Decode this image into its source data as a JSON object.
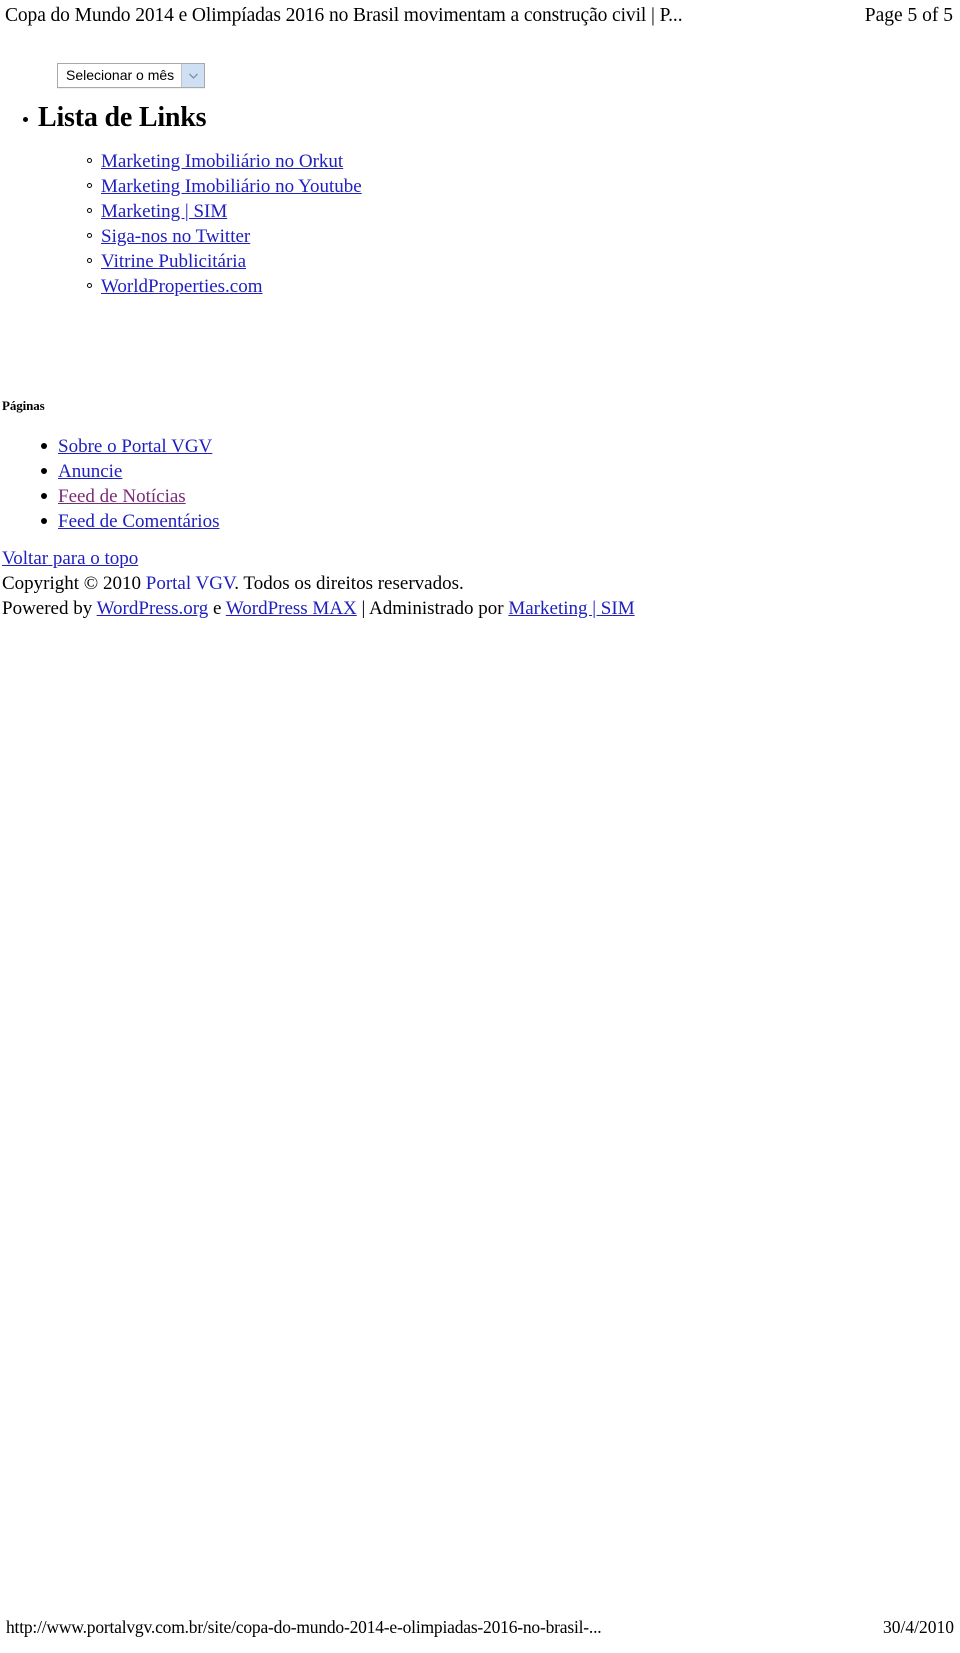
{
  "print_header": {
    "document_title": "Copa do Mundo 2014 e Olimpíadas 2016 no Brasil movimentam a construção civil | P...",
    "page_indicator": "Page 5 of 5"
  },
  "month_select": {
    "selected_label": "Selecionar o mês",
    "arrow_icon": "chevron-down-icon",
    "arrow_button_color": "#cfe0f5",
    "border_color": "#a9a9a9"
  },
  "links_widget": {
    "title": "Lista de Links",
    "items": [
      {
        "label": "Marketing Imobiliário no Orkut",
        "state": "link"
      },
      {
        "label": "Marketing Imobiliário no Youtube",
        "state": "link"
      },
      {
        "label": "Marketing | SIM",
        "state": "link"
      },
      {
        "label": "Siga-nos no Twitter",
        "state": "link"
      },
      {
        "label": "Vitrine Publicitária",
        "state": "link"
      },
      {
        "label": "WorldProperties.com",
        "state": "link"
      }
    ]
  },
  "pages_widget": {
    "heading": "Páginas",
    "items": [
      {
        "label": "Sobre o Portal VGV",
        "state": "link"
      },
      {
        "label": "Anuncie",
        "state": "link"
      },
      {
        "label": "Feed de Notícias",
        "state": "visited"
      },
      {
        "label": "Feed de Comentários",
        "state": "link"
      }
    ]
  },
  "site_footer": {
    "back_to_top": "Voltar para o topo",
    "copyright_prefix": "Copyright © 2010 ",
    "copyright_link": "Portal VGV",
    "copyright_suffix": ". Todos os direitos reservados.",
    "powered_prefix": "Powered by ",
    "powered_link_1": "WordPress.org",
    "powered_mid": " e ",
    "powered_link_2": "WordPress MAX",
    "powered_admin_prefix": " | Administrado por ",
    "powered_link_3": "Marketing | SIM"
  },
  "print_footer": {
    "url": "http://www.portalvgv.com.br/site/copa-do-mundo-2014-e-olimpiadas-2016-no-brasil-...",
    "date": "30/4/2010"
  },
  "colors": {
    "link": "#2020c0",
    "visited": "#7a2a78",
    "text": "#000000",
    "background": "#ffffff"
  }
}
